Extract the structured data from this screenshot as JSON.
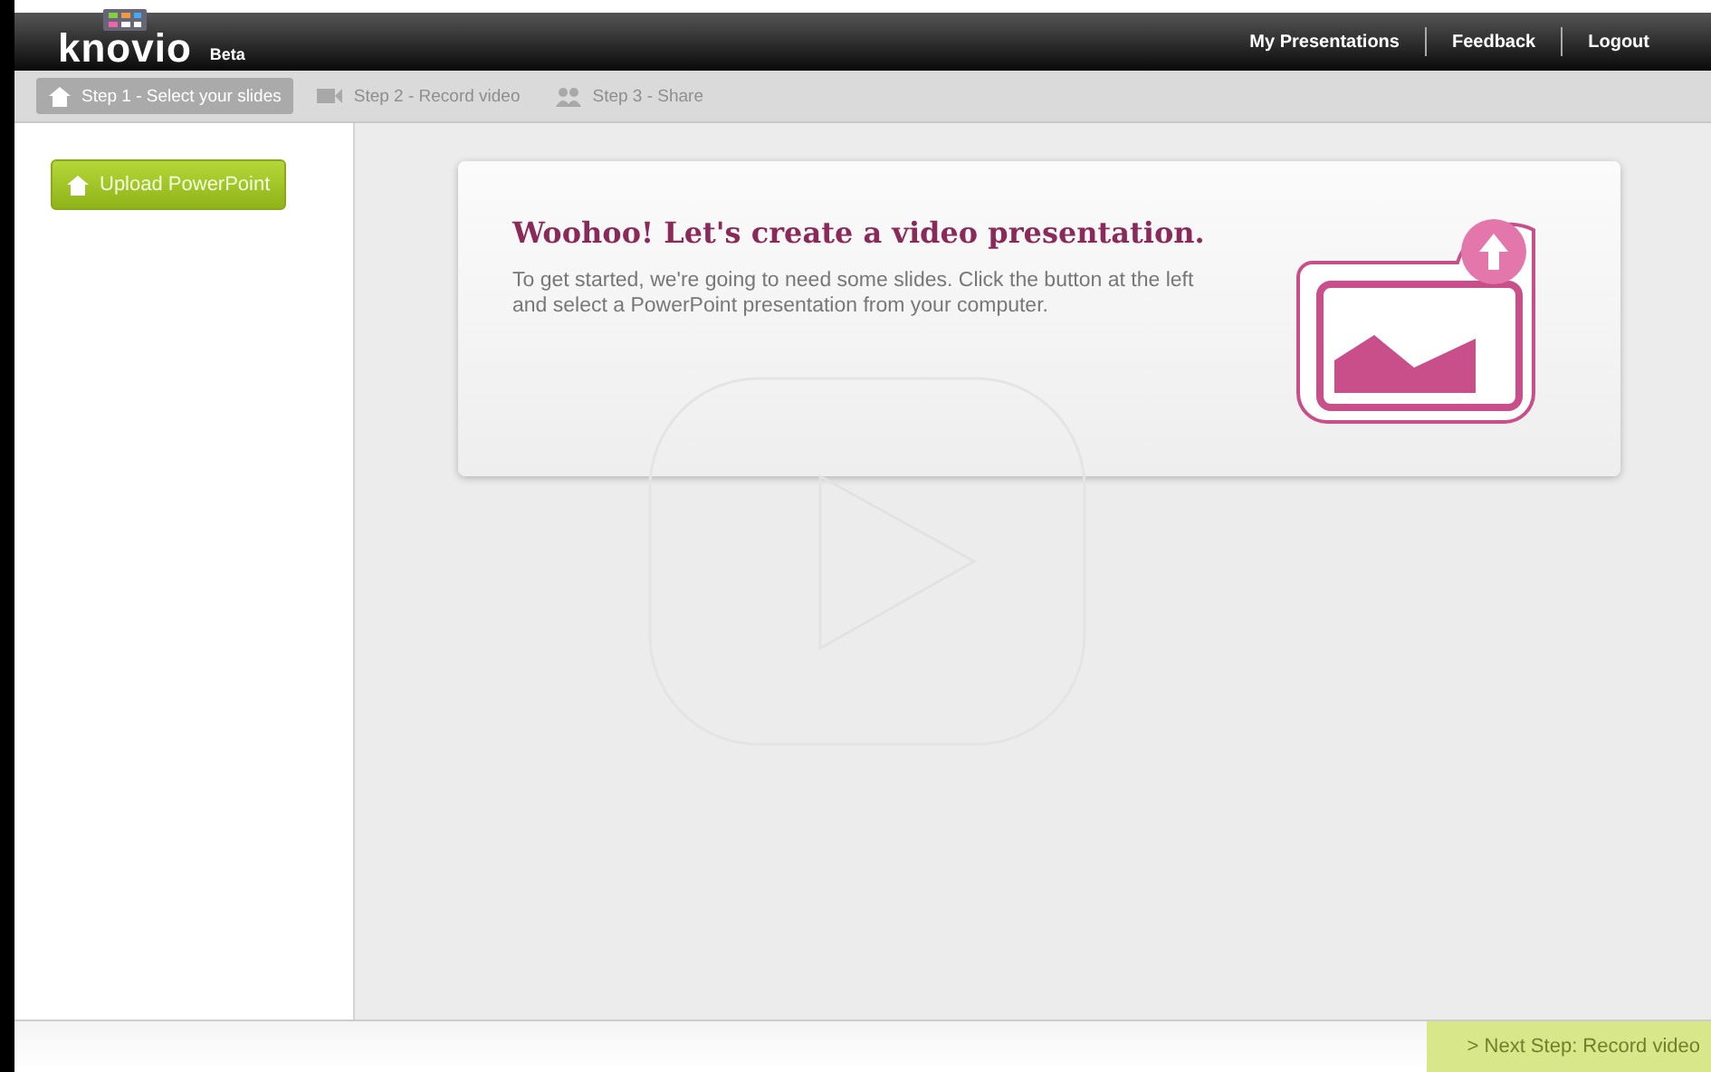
{
  "header": {
    "logo": "knovio",
    "badge": "Beta",
    "links": [
      {
        "label": "My Presentations"
      },
      {
        "label": "Feedback"
      },
      {
        "label": "Logout"
      }
    ]
  },
  "steps": [
    {
      "label": "Step 1 - Select your slides",
      "selected": true,
      "kind": "home"
    },
    {
      "label": "Step 2 - Record video",
      "selected": false,
      "kind": "camera"
    },
    {
      "label": "Step 3 - Share",
      "selected": false,
      "kind": "people"
    }
  ],
  "sidebar": {
    "upload_button": "Upload PowerPoint"
  },
  "card": {
    "title": "Woohoo! Let's create a video presentation.",
    "body": "To get started, we're going to need some slides. Click the button at the left and select a PowerPoint presentation from your computer."
  },
  "footer": {
    "next_button": {
      "label": "> Next Step: Record video",
      "disabled": true
    }
  }
}
